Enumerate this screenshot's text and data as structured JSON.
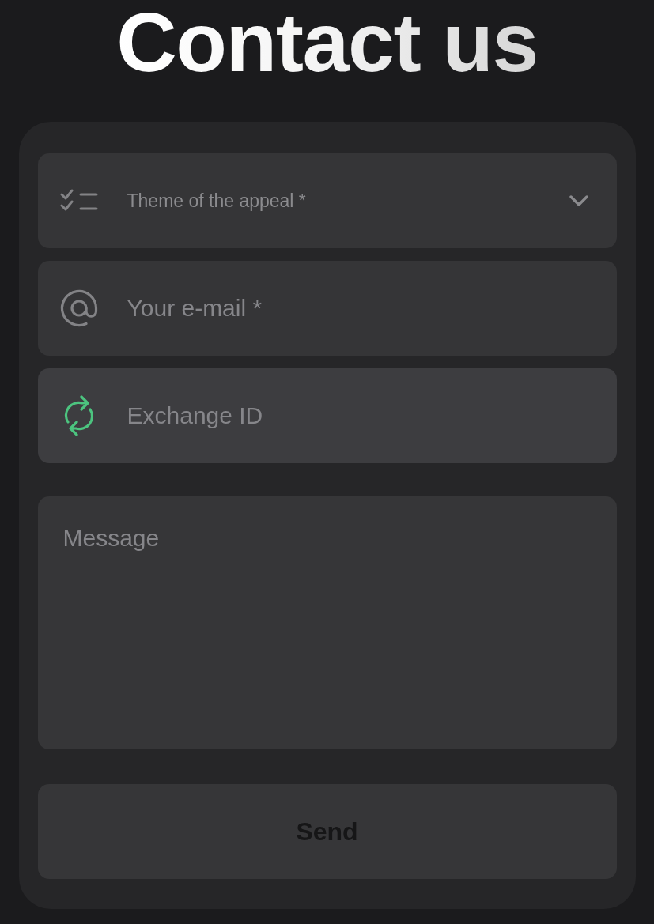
{
  "title": "Contact us",
  "form": {
    "fields": [
      {
        "kind": "select",
        "placeholder": "Theme of the appeal *",
        "focused": false
      },
      {
        "kind": "email",
        "placeholder": "Your e-mail *",
        "focused": false
      },
      {
        "kind": "id",
        "placeholder": "Exchange ID",
        "focused": true
      }
    ],
    "message": {
      "placeholder": "Message"
    },
    "send_button": {
      "label": "Send",
      "disabled": true
    }
  }
}
